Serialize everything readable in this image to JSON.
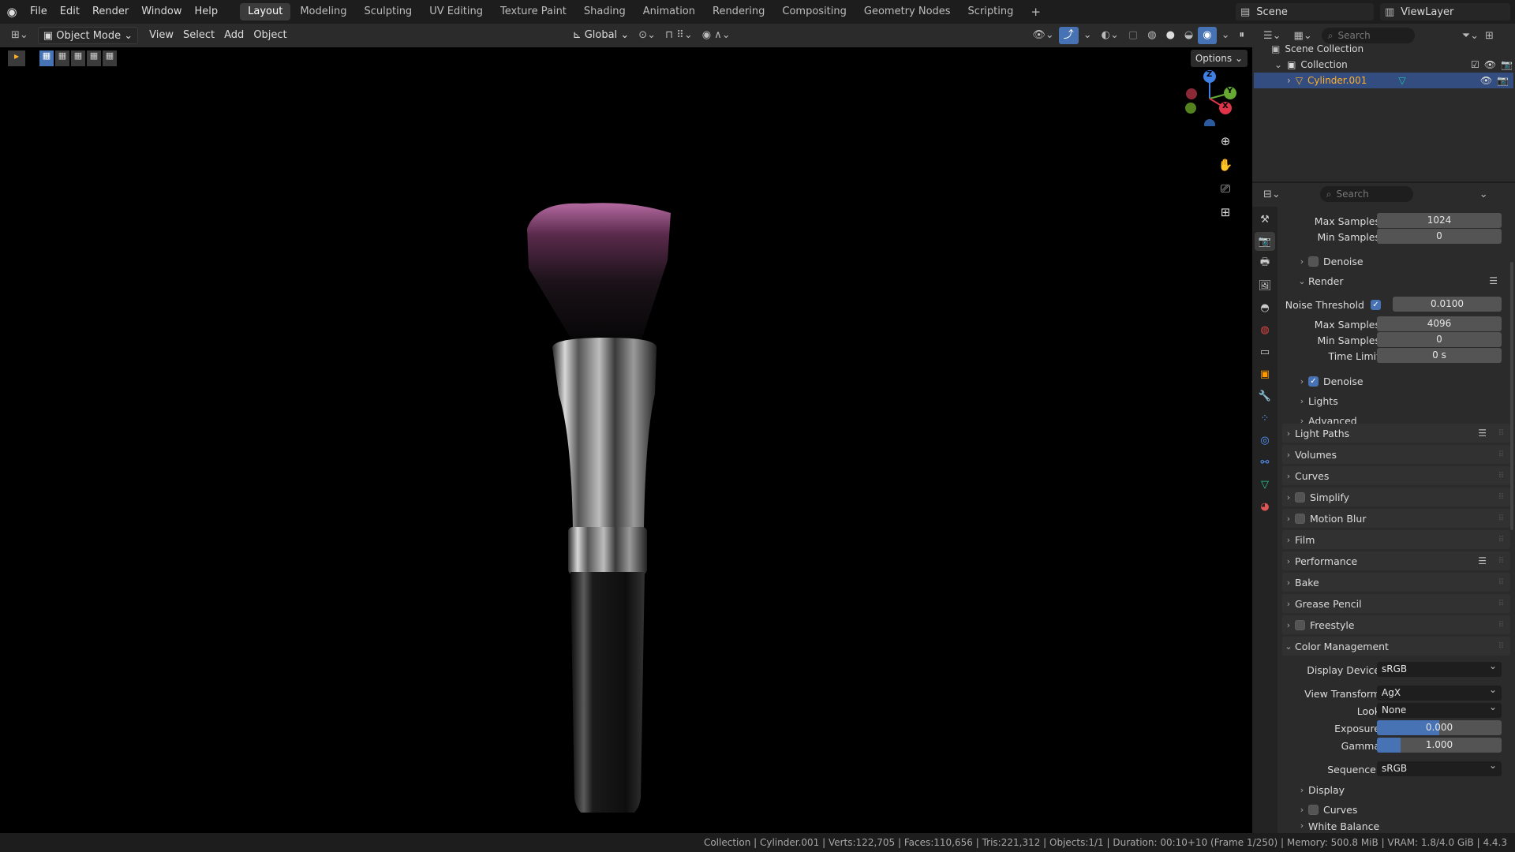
{
  "topbar": {
    "menus": [
      "File",
      "Edit",
      "Render",
      "Window",
      "Help"
    ],
    "workspaces": [
      "Layout",
      "Modeling",
      "Sculpting",
      "UV Editing",
      "Texture Paint",
      "Shading",
      "Animation",
      "Rendering",
      "Compositing",
      "Geometry Nodes",
      "Scripting"
    ],
    "active_workspace": "Layout",
    "add_tab": "+",
    "scene_name": "Scene",
    "view_layer": "ViewLayer"
  },
  "viewport_header": {
    "mode": "Object Mode",
    "menus": [
      "View",
      "Select",
      "Add",
      "Object"
    ],
    "transform_orientation": "Global",
    "options": "Options"
  },
  "gizmo": {
    "x": "X",
    "y": "Y",
    "z": "Z"
  },
  "outliner": {
    "search_placeholder": "Search",
    "scene_collection": "Scene Collection",
    "collection": "Collection",
    "object": "Cylinder.001"
  },
  "properties": {
    "search_placeholder": "Search",
    "viewport": {
      "max_samples_label": "Max Samples",
      "max_samples": "1024",
      "min_samples_label": "Min Samples",
      "min_samples": "0",
      "denoise": "Denoise"
    },
    "render": {
      "title": "Render",
      "noise_threshold_label": "Noise Threshold",
      "noise_threshold": "0.0100",
      "max_samples_label": "Max Samples",
      "max_samples": "4096",
      "min_samples_label": "Min Samples",
      "min_samples": "0",
      "time_limit_label": "Time Limit",
      "time_limit": "0 s",
      "denoise": "Denoise",
      "lights": "Lights",
      "advanced": "Advanced"
    },
    "panels": [
      "Light Paths",
      "Volumes",
      "Curves",
      "Simplify",
      "Motion Blur",
      "Film",
      "Performance",
      "Bake",
      "Grease Pencil",
      "Freestyle"
    ],
    "color_management": {
      "title": "Color Management",
      "display_device_label": "Display Device",
      "display_device": "sRGB",
      "view_transform_label": "View Transform",
      "view_transform": "AgX",
      "look_label": "Look",
      "look": "None",
      "exposure_label": "Exposure",
      "exposure": "0.000",
      "exposure_fill": 0.5,
      "gamma_label": "Gamma",
      "gamma": "1.000",
      "gamma_fill": 0.19,
      "sequencer_label": "Sequencer",
      "sequencer": "sRGB",
      "display": "Display",
      "curves": "Curves",
      "white_balance": "White Balance"
    }
  },
  "statusbar": {
    "text": "Collection | Cylinder.001 | Verts:122,705 | Faces:110,656 | Tris:221,312 | Objects:1/1 | Duration: 00:10+10 (Frame 1/250) | Memory: 500.8 MiB | VRAM: 1.8/4.0 GiB | 4.4.3"
  },
  "colors": {
    "accent": "#4772b3",
    "active_object": "#ffaf29",
    "bristle_tip": "#b46aa0"
  }
}
